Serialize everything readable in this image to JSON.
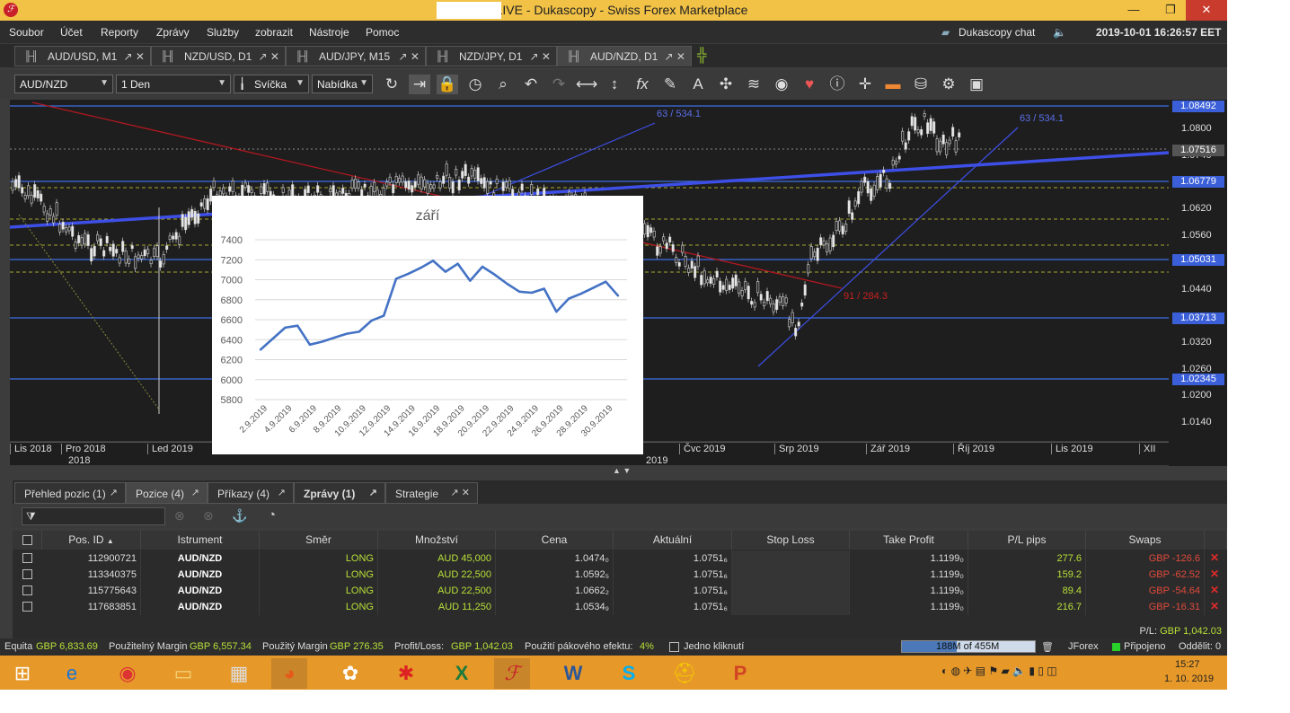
{
  "window": {
    "title": "@ LIVE - Dukascopy - Swiss Forex Marketplace",
    "controls": {
      "minimize": "—",
      "maximize": "❐",
      "close": "✕"
    }
  },
  "menu": [
    "Soubor",
    "Účet",
    "Reporty",
    "Zprávy",
    "Služby",
    "zobrazit",
    "Nástroje",
    "Pomoc"
  ],
  "header_right": {
    "chat": "Dukascopy chat",
    "datetime": "2019-10-01 16:26:57 EET"
  },
  "tabs": [
    "AUD/USD, M1",
    "NZD/USD, D1",
    "AUD/JPY, M15",
    "NZD/JPY, D1",
    "AUD/NZD, D1"
  ],
  "toolbar": {
    "instrument": "AUD/NZD",
    "period": "1 Den",
    "chart_type": "Svíčka",
    "offer_side": "Nabídka"
  },
  "price_scale": {
    "ticks": [
      "1.0800",
      "1.0740",
      "1.0620",
      "1.0560",
      "1.0440",
      "1.0320",
      "1.0260",
      "1.0200",
      "1.0140"
    ],
    "boxes": [
      "1.08492",
      "1.07516",
      "1.06779",
      "1.05031",
      "1.03713",
      "1.02345"
    ]
  },
  "time_scale": {
    "months": [
      "Lis 2018",
      "Pro 2018",
      "Led 2019",
      "Čvc 2019",
      "Srp 2019",
      "Zář 2019",
      "Říj 2019",
      "Lis 2019",
      "XII"
    ],
    "years": [
      "2018",
      "2019"
    ]
  },
  "chart_annotations": {
    "fib_top_left": "63 / 534.1",
    "fib_top_right": "63 / 534.1",
    "fib_red": "91 / 284.3"
  },
  "excel_chart": {
    "title": "září",
    "chart_data": {
      "type": "line",
      "title": "září",
      "ylim": [
        5800,
        7400
      ],
      "y_ticks": [
        "7400",
        "7200",
        "7000",
        "6800",
        "6600",
        "6400",
        "6200",
        "6000",
        "5800"
      ],
      "x_labels": [
        "2.9.2019",
        "4.9.2019",
        "6.9.2019",
        "8.9.2019",
        "10.9.2019",
        "12.9.2019",
        "14.9.2019",
        "16.9.2019",
        "18.9.2019",
        "20.9.2019",
        "22.9.2019",
        "24.9.2019",
        "26.9.2019",
        "28.9.2019",
        "30.9.2019"
      ],
      "values": [
        6300,
        6410,
        6520,
        6540,
        6350,
        6380,
        6420,
        6460,
        6480,
        6590,
        6640,
        7010,
        7060,
        7120,
        7190,
        7080,
        7160,
        6990,
        7130,
        7050,
        6960,
        6880,
        6870,
        6910,
        6680,
        6810,
        6860,
        6920,
        6980,
        6840
      ],
      "color": "#4472c4"
    }
  },
  "bottom_tabs": [
    "Přehled pozic (1)",
    "Pozice (4)",
    "Příkazy (4)",
    "Zprávy (1)",
    "Strategie"
  ],
  "table": {
    "columns": [
      "Pos. ID",
      "Istrument",
      "Směr",
      "Množství",
      "Cena",
      "Aktuální",
      "Stop Loss",
      "Take Profit",
      "P/L pips",
      "Swaps"
    ],
    "rows": [
      {
        "id": "112900721",
        "instrument": "AUD/NZD",
        "side": "LONG",
        "amount": "AUD 45,000",
        "price": "1.0474₀",
        "current": "1.0751₆",
        "stop": "",
        "tp": "1.1199₀",
        "pips": "277.6",
        "swaps": "GBP -126.6"
      },
      {
        "id": "113340375",
        "instrument": "AUD/NZD",
        "side": "LONG",
        "amount": "AUD 22,500",
        "price": "1.0592₅",
        "current": "1.0751₆",
        "stop": "",
        "tp": "1.1199₀",
        "pips": "159.2",
        "swaps": "GBP -62.52"
      },
      {
        "id": "115775643",
        "instrument": "AUD/NZD",
        "side": "LONG",
        "amount": "AUD 22,500",
        "price": "1.0662₂",
        "current": "1.0751₆",
        "stop": "",
        "tp": "1.1199₀",
        "pips": "89.4",
        "swaps": "GBP -54.64"
      },
      {
        "id": "117683851",
        "instrument": "AUD/NZD",
        "side": "LONG",
        "amount": "AUD 11,250",
        "price": "1.0534₉",
        "current": "1.0751₆",
        "stop": "",
        "tp": "1.1199₀",
        "pips": "216.7",
        "swaps": "GBP -16.31"
      }
    ],
    "total_pl_label": "P/L:",
    "total_pl": "GBP 1,042.03"
  },
  "status": {
    "equity_label": "Equita",
    "equity": "GBP 6,833.69",
    "usable_label": "Použitelný Margin",
    "usable": "GBP 6,557.34",
    "used_label": "Použitý Margin",
    "used": "GBP 276.35",
    "pl_label": "Profit/Loss:",
    "pl": "GBP 1,042.03",
    "lev_label": "Použití pákového efektu:",
    "lev": "4%",
    "one_click": "Jedno kliknutí",
    "memory": "188M of 455M",
    "platform": "JForex",
    "connected": "Připojeno",
    "detached": "Oddělit: 0"
  },
  "taskbar": {
    "time": "15:27",
    "date": "1. 10. 2019"
  }
}
